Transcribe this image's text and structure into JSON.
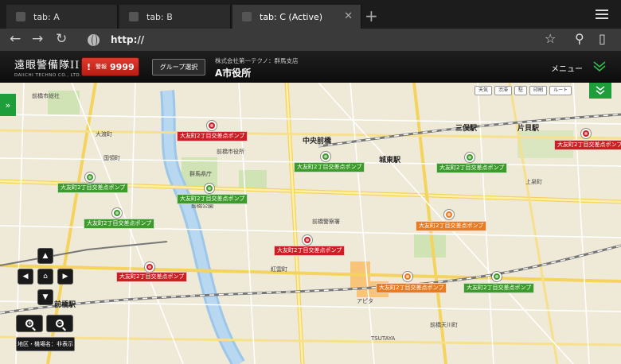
{
  "browser": {
    "tabs": [
      {
        "label": "tab: A"
      },
      {
        "label": "tab: B"
      },
      {
        "label": "tab: C  (Active)"
      }
    ],
    "url": "http://"
  },
  "header": {
    "logo_main": "遠眼警備隊II",
    "logo_sub": "DAIICHI TECHNO CO., LTD.",
    "alarm_bang": "!",
    "alarm_label": "警報",
    "alarm_count": "9999",
    "group_button": "グループ選択",
    "company": "株式会社第一テクノ：群馬支店",
    "office": "A市役所",
    "menu": "メニュー"
  },
  "map": {
    "toolbar": [
      "天気",
      "渋滞",
      "駐",
      "印刷",
      "ルート"
    ],
    "stations": [
      {
        "name": "三俣駅"
      },
      {
        "name": "片貝駅"
      },
      {
        "name": "城東駅"
      },
      {
        "name": "中央前橋"
      },
      {
        "name": "前橋駅"
      }
    ],
    "places": [
      {
        "name": "前橋市役所"
      },
      {
        "name": "群馬県庁"
      },
      {
        "name": "前橋公園"
      },
      {
        "name": "アピタ"
      },
      {
        "name": "TSUTAYA"
      },
      {
        "name": "前橋警察署"
      },
      {
        "name": "大渡町"
      },
      {
        "name": "国領町"
      },
      {
        "name": "前橋天川町"
      },
      {
        "name": "紅雲町"
      },
      {
        "name": "上泉町"
      },
      {
        "name": "前橋市総社"
      }
    ],
    "pumps": [
      {
        "label": "大友町2丁目交差点ポンプ",
        "status": "red"
      },
      {
        "label": "大友町2丁目交差点ポンプ",
        "status": "red"
      },
      {
        "label": "大友町2丁目交差点ポンプ",
        "status": "red"
      },
      {
        "label": "大友町2丁目交差点ポンプ",
        "status": "red"
      },
      {
        "label": "大友町2丁目交差点ポンプ",
        "status": "green"
      },
      {
        "label": "大友町2丁目交差点ポンプ",
        "status": "green"
      },
      {
        "label": "大友町2丁目交差点ポンプ",
        "status": "green"
      },
      {
        "label": "大友町2丁目交差点ポンプ",
        "status": "green"
      },
      {
        "label": "大友町2丁目交差点ポンプ",
        "status": "green"
      },
      {
        "label": "大友町2丁目交差点ポンプ",
        "status": "green"
      },
      {
        "label": "大友町2丁目交差点ポンプ",
        "status": "orange"
      },
      {
        "label": "大友町2丁目交差点ポンプ",
        "status": "orange"
      }
    ],
    "show_names_button": "地区・機場名：非表示"
  },
  "colors": {
    "alarm_red": "#cc1f24",
    "ok_green": "#3c9b2a",
    "warn_orange": "#e97b22",
    "accent_green": "#1e9e3a"
  }
}
